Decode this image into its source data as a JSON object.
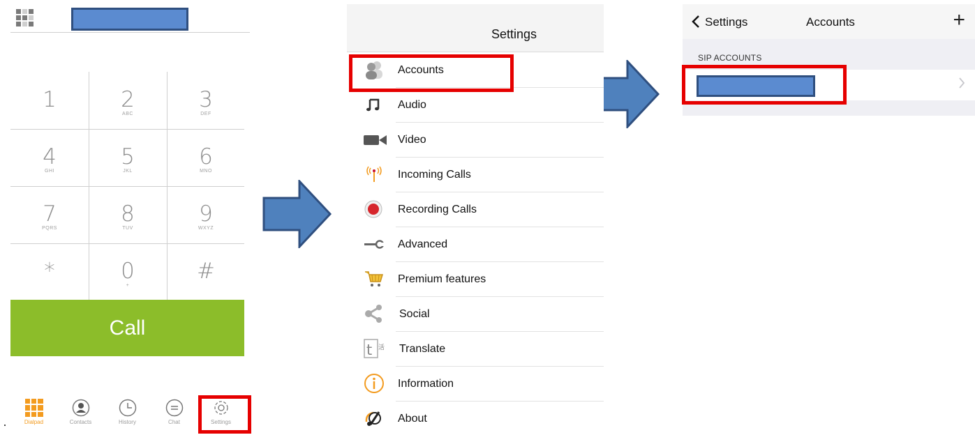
{
  "dialpad": {
    "keys": [
      {
        "digit": "1",
        "letters": ""
      },
      {
        "digit": "2",
        "letters": "ABC"
      },
      {
        "digit": "3",
        "letters": "DEF"
      },
      {
        "digit": "4",
        "letters": "GHI"
      },
      {
        "digit": "5",
        "letters": "JKL"
      },
      {
        "digit": "6",
        "letters": "MNO"
      },
      {
        "digit": "7",
        "letters": "PQRS"
      },
      {
        "digit": "8",
        "letters": "TUV"
      },
      {
        "digit": "9",
        "letters": "WXYZ"
      },
      {
        "digit": "*",
        "letters": ""
      },
      {
        "digit": "0",
        "letters": "+"
      },
      {
        "digit": "#",
        "letters": ""
      }
    ],
    "call_label": "Call",
    "tabs": [
      {
        "label": "Dialpad",
        "icon": "dialpad-icon"
      },
      {
        "label": "Contacts",
        "icon": "contacts-icon"
      },
      {
        "label": "History",
        "icon": "history-icon"
      },
      {
        "label": "Chat",
        "icon": "chat-icon"
      },
      {
        "label": "Settings",
        "icon": "gear-icon"
      }
    ],
    "accent_color": "#8cbd2a",
    "active_tab_color": "#f39b1f"
  },
  "settings": {
    "title": "Settings",
    "items": [
      {
        "label": "Accounts",
        "icon": "accounts-icon"
      },
      {
        "label": "Audio",
        "icon": "music-note-icon"
      },
      {
        "label": "Video",
        "icon": "video-camera-icon"
      },
      {
        "label": "Incoming Calls",
        "icon": "antenna-icon"
      },
      {
        "label": "Recording Calls",
        "icon": "record-icon"
      },
      {
        "label": "Advanced",
        "icon": "wrench-icon"
      },
      {
        "label": "Premium features",
        "icon": "cart-icon"
      },
      {
        "label": "Social",
        "icon": "share-icon"
      },
      {
        "label": "Translate",
        "icon": "translate-icon"
      },
      {
        "label": "Information",
        "icon": "info-icon"
      },
      {
        "label": "About",
        "icon": "about-icon"
      }
    ]
  },
  "accounts": {
    "back_label": "Settings",
    "title": "Accounts",
    "add_label": "+",
    "section_label": "SIP ACCOUNTS"
  },
  "highlight_color": "#e60000",
  "redaction_color": "#5b8bd0"
}
